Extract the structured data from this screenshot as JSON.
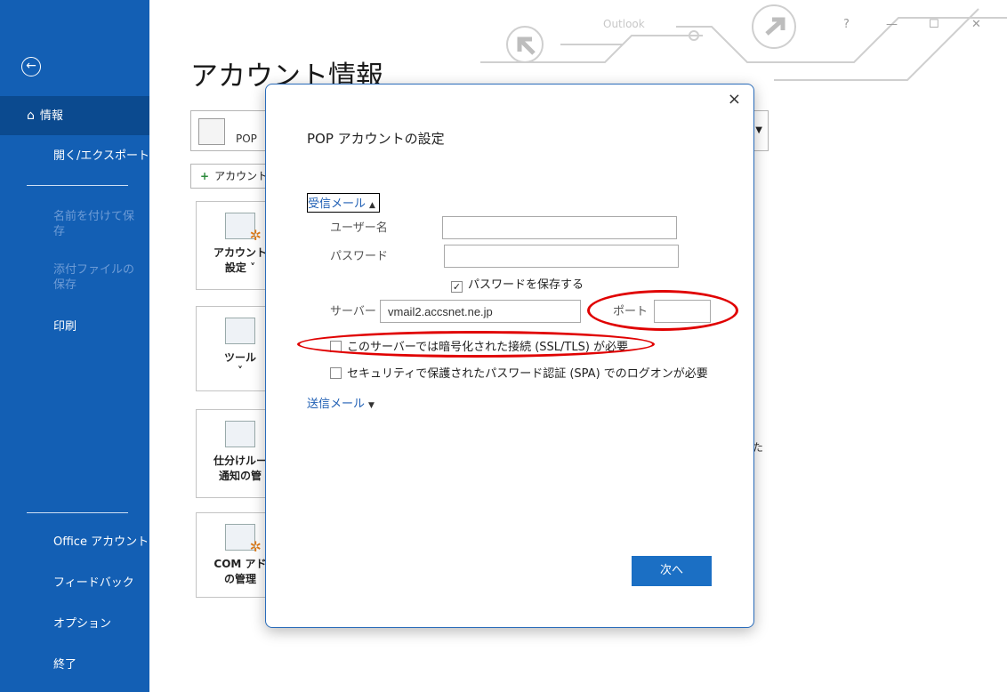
{
  "titlebar": {
    "app_title": "Outlook",
    "help_label": "?",
    "minimize_label": "—",
    "maximize_label": "☐",
    "close_label": "✕"
  },
  "sidebar": {
    "back_icon": "←",
    "items": [
      {
        "label": "情報",
        "active": true
      },
      {
        "label": "開く/エクスポート"
      },
      {
        "label": "名前を付けて保存",
        "disabled": true
      },
      {
        "label": "添付ファイルの保存",
        "disabled": true
      },
      {
        "label": "印刷"
      },
      {
        "label": "Office アカウント"
      },
      {
        "label": "フィードバック"
      },
      {
        "label": "オプション"
      },
      {
        "label": "終了"
      }
    ],
    "home_icon": "⌂"
  },
  "main": {
    "heading": "アカウント情報",
    "account_select": {
      "text": "POP"
    },
    "add_account_label": "アカウント",
    "tiles": [
      {
        "line1": "アカウント",
        "line2": "設定 ˅"
      },
      {
        "line1": "ツール",
        "line2": "˅"
      },
      {
        "line1": "仕分けルー",
        "line2": "通知の管"
      },
      {
        "line1": "COM アド",
        "line2": "の管理"
      }
    ],
    "stray_char": "た"
  },
  "dialog": {
    "close_label": "×",
    "title": "POP アカウントの設定",
    "incoming_section": "受信メール",
    "username_label": "ユーザー名",
    "username_value": "",
    "password_label": "パスワード",
    "password_value": "",
    "save_password_label": "パスワードを保存する",
    "save_password_checked": true,
    "server_label": "サーバー",
    "server_value": "vmail2.accsnet.ne.jp",
    "port_label": "ポート",
    "port_value": "",
    "ssl_label": "このサーバーでは暗号化された接続 (SSL/TLS) が必要",
    "spa_label": "セキュリティで保護されたパスワード認証 (SPA) でのログオンが必要",
    "outgoing_section": "送信メール",
    "next_label": "次へ"
  },
  "colors": {
    "sidebar_bg": "#135fb4",
    "sidebar_active": "#0b4a8f",
    "accent": "#1b6fc4",
    "annotation": "#e00000"
  }
}
